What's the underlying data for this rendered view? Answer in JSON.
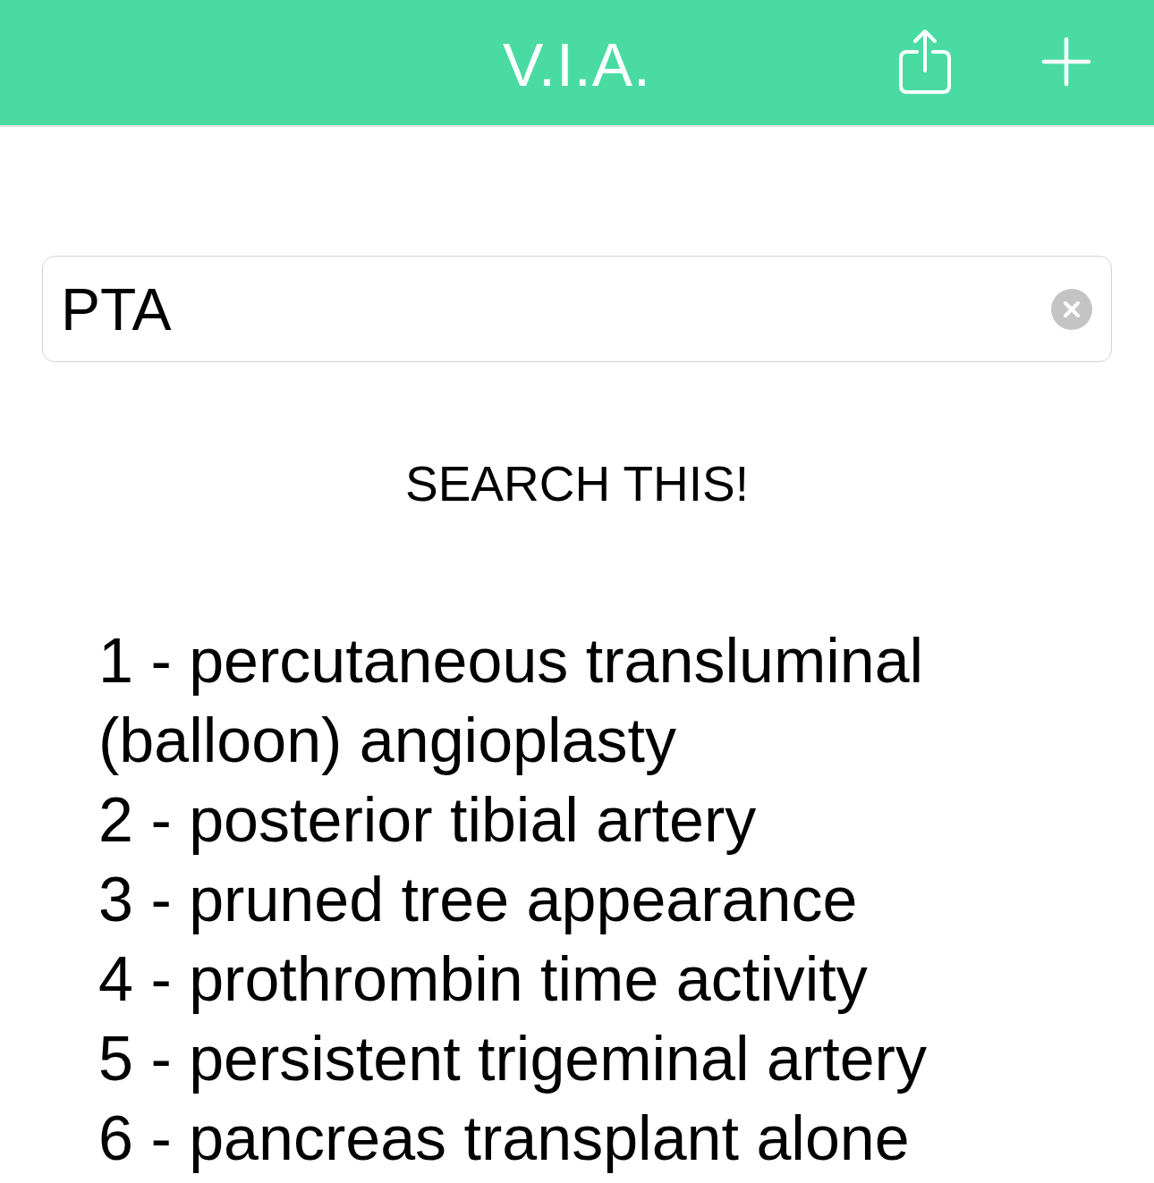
{
  "header": {
    "title": "V.I.A."
  },
  "search": {
    "value": "PTA"
  },
  "search_button": {
    "label": "SEARCH THIS!"
  },
  "results": [
    "1 - percutaneous transluminal (balloon) angioplasty",
    "2 - posterior tibial artery",
    "3 - pruned tree appearance",
    "4 - prothrombin time activity",
    "5 - persistent trigeminal artery",
    "6 - pancreas transplant alone"
  ]
}
